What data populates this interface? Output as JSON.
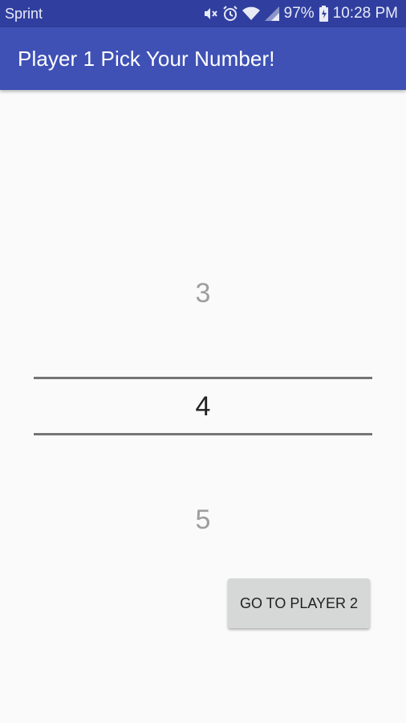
{
  "status_bar": {
    "carrier": "Sprint",
    "battery": "97%",
    "time": "10:28 PM",
    "icons": [
      "mute-icon",
      "alarm-icon",
      "wifi-icon",
      "signal-icon",
      "battery-charging-icon"
    ]
  },
  "app_bar": {
    "title": "Player 1 Pick Your Number!",
    "color": "#3f51b5"
  },
  "number_picker": {
    "previous": "3",
    "current": "4",
    "next": "5"
  },
  "actions": {
    "go_label": "GO TO PLAYER 2"
  }
}
